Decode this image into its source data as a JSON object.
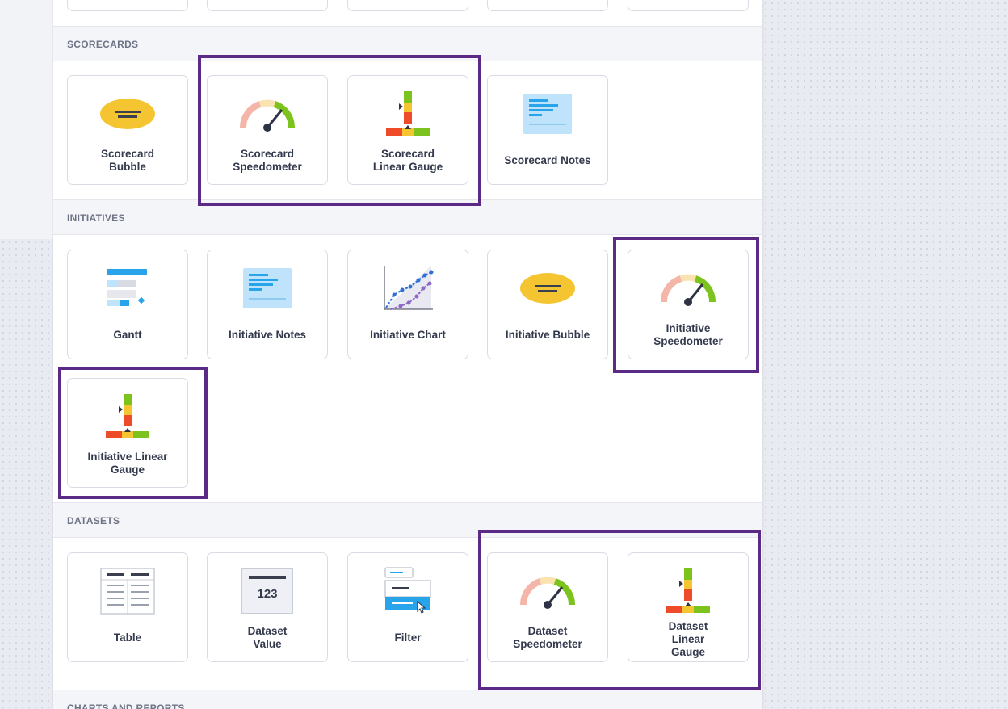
{
  "sections": {
    "scorecards": "SCORECARDS",
    "initiatives": "INITIATIVES",
    "datasets": "DATASETS",
    "charts_and_reports": "CHARTS AND REPORTS"
  },
  "scorecards": {
    "bubble": "Scorecard\nBubble",
    "speedometer": "Scorecard\nSpeedometer",
    "linear_gauge": "Scorecard\nLinear Gauge",
    "notes": "Scorecard Notes"
  },
  "initiatives": {
    "gantt": "Gantt",
    "notes": "Initiative Notes",
    "chart": "Initiative Chart",
    "bubble": "Initiative Bubble",
    "speedometer": "Initiative\nSpeedometer",
    "linear_gauge": "Initiative Linear\nGauge"
  },
  "datasets": {
    "table": "Table",
    "value": "Dataset\nValue",
    "value_icon_text": "123",
    "filter": "Filter",
    "speedometer": "Dataset\nSpeedometer",
    "linear_gauge": "Dataset\nLinear\nGauge"
  },
  "colors": {
    "highlight": "#5b2a86",
    "gauge_green": "#7dc31e",
    "gauge_yellow": "#f5c431",
    "gauge_red": "#ee4b2b",
    "notes_blue": "#bfe3fa",
    "filter_blue": "#27a4ea"
  }
}
